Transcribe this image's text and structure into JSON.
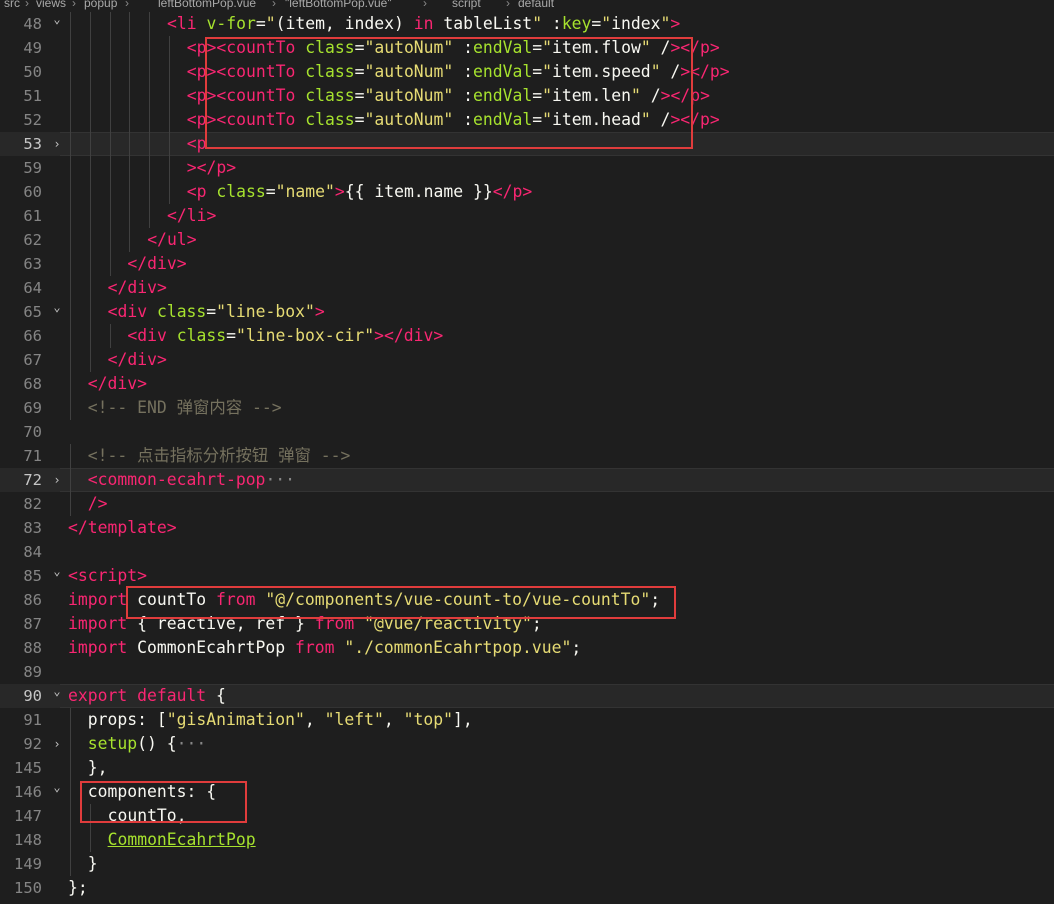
{
  "breadcrumb": {
    "items": [
      "src",
      "views",
      "popup",
      "leftBottomPop.vue",
      "\"leftBottomPop.vue\"",
      "script",
      "default"
    ],
    "icons": [
      "chevron-right-icon",
      "vue-file-icon",
      "braces-icon",
      "cube-icon",
      "symbol-icon"
    ]
  },
  "lines": [
    {
      "n": "48",
      "fold": "v",
      "indent": 5,
      "segs": [
        [
          "tag",
          "<"
        ],
        [
          "tag",
          "li"
        ],
        [
          "punc",
          " "
        ],
        [
          "attr",
          "v-for"
        ],
        [
          "punc",
          "="
        ],
        [
          "str",
          "\""
        ],
        [
          "var",
          "(item, index) "
        ],
        [
          "kw",
          "in"
        ],
        [
          "var",
          " tableList"
        ],
        [
          "str",
          "\""
        ],
        [
          "punc",
          " :"
        ],
        [
          "attr",
          "key"
        ],
        [
          "punc",
          "="
        ],
        [
          "str",
          "\""
        ],
        [
          "var",
          "index"
        ],
        [
          "str",
          "\""
        ],
        [
          "tag",
          ">"
        ]
      ]
    },
    {
      "n": "49",
      "fold": "",
      "indent": 6,
      "segs": [
        [
          "tag",
          "<"
        ],
        [
          "tag",
          "p"
        ],
        [
          "tag",
          "><"
        ],
        [
          "tag",
          "countTo"
        ],
        [
          "punc",
          " "
        ],
        [
          "attr",
          "class"
        ],
        [
          "punc",
          "="
        ],
        [
          "str",
          "\"autoNum\""
        ],
        [
          "punc",
          " :"
        ],
        [
          "attr",
          "endVal"
        ],
        [
          "punc",
          "="
        ],
        [
          "str",
          "\""
        ],
        [
          "var",
          "item.flow"
        ],
        [
          "str",
          "\""
        ],
        [
          "punc",
          " /"
        ],
        [
          "tag",
          "></"
        ],
        [
          "tag",
          "p"
        ],
        [
          "tag",
          ">"
        ]
      ]
    },
    {
      "n": "50",
      "fold": "",
      "indent": 6,
      "segs": [
        [
          "tag",
          "<"
        ],
        [
          "tag",
          "p"
        ],
        [
          "tag",
          "><"
        ],
        [
          "tag",
          "countTo"
        ],
        [
          "punc",
          " "
        ],
        [
          "attr",
          "class"
        ],
        [
          "punc",
          "="
        ],
        [
          "str",
          "\"autoNum\""
        ],
        [
          "punc",
          " :"
        ],
        [
          "attr",
          "endVal"
        ],
        [
          "punc",
          "="
        ],
        [
          "str",
          "\""
        ],
        [
          "var",
          "item.speed"
        ],
        [
          "str",
          "\""
        ],
        [
          "punc",
          " /"
        ],
        [
          "tag",
          "></"
        ],
        [
          "tag",
          "p"
        ],
        [
          "tag",
          ">"
        ]
      ]
    },
    {
      "n": "51",
      "fold": "",
      "indent": 6,
      "segs": [
        [
          "tag",
          "<"
        ],
        [
          "tag",
          "p"
        ],
        [
          "tag",
          "><"
        ],
        [
          "tag",
          "countTo"
        ],
        [
          "punc",
          " "
        ],
        [
          "attr",
          "class"
        ],
        [
          "punc",
          "="
        ],
        [
          "str",
          "\"autoNum\""
        ],
        [
          "punc",
          " :"
        ],
        [
          "attr",
          "endVal"
        ],
        [
          "punc",
          "="
        ],
        [
          "str",
          "\""
        ],
        [
          "var",
          "item.len"
        ],
        [
          "str",
          "\""
        ],
        [
          "punc",
          " /"
        ],
        [
          "tag",
          "></"
        ],
        [
          "tag",
          "p"
        ],
        [
          "tag",
          ">"
        ]
      ]
    },
    {
      "n": "52",
      "fold": "",
      "indent": 6,
      "segs": [
        [
          "tag",
          "<"
        ],
        [
          "tag",
          "p"
        ],
        [
          "tag",
          "><"
        ],
        [
          "tag",
          "countTo"
        ],
        [
          "punc",
          " "
        ],
        [
          "attr",
          "class"
        ],
        [
          "punc",
          "="
        ],
        [
          "str",
          "\"autoNum\""
        ],
        [
          "punc",
          " :"
        ],
        [
          "attr",
          "endVal"
        ],
        [
          "punc",
          "="
        ],
        [
          "str",
          "\""
        ],
        [
          "var",
          "item.head"
        ],
        [
          "str",
          "\""
        ],
        [
          "punc",
          " /"
        ],
        [
          "tag",
          "></"
        ],
        [
          "tag",
          "p"
        ],
        [
          "tag",
          ">"
        ]
      ]
    },
    {
      "n": "53",
      "fold": ">",
      "indent": 6,
      "hl": true,
      "segs": [
        [
          "tag",
          "<"
        ],
        [
          "tag",
          "p"
        ]
      ]
    },
    {
      "n": "59",
      "fold": "",
      "indent": 6,
      "segs": [
        [
          "tag",
          "></"
        ],
        [
          "tag",
          "p"
        ],
        [
          "tag",
          ">"
        ]
      ]
    },
    {
      "n": "60",
      "fold": "",
      "indent": 6,
      "segs": [
        [
          "tag",
          "<"
        ],
        [
          "tag",
          "p"
        ],
        [
          "punc",
          " "
        ],
        [
          "attr",
          "class"
        ],
        [
          "punc",
          "="
        ],
        [
          "str",
          "\"name\""
        ],
        [
          "tag",
          ">"
        ],
        [
          "var",
          "{{ item.name }}"
        ],
        [
          "tag",
          "</"
        ],
        [
          "tag",
          "p"
        ],
        [
          "tag",
          ">"
        ]
      ]
    },
    {
      "n": "61",
      "fold": "",
      "indent": 5,
      "segs": [
        [
          "tag",
          "</"
        ],
        [
          "tag",
          "li"
        ],
        [
          "tag",
          ">"
        ]
      ]
    },
    {
      "n": "62",
      "fold": "",
      "indent": 4,
      "segs": [
        [
          "tag",
          "</"
        ],
        [
          "tag",
          "ul"
        ],
        [
          "tag",
          ">"
        ]
      ]
    },
    {
      "n": "63",
      "fold": "",
      "indent": 3,
      "segs": [
        [
          "tag",
          "</"
        ],
        [
          "tag",
          "div"
        ],
        [
          "tag",
          ">"
        ]
      ]
    },
    {
      "n": "64",
      "fold": "",
      "indent": 2,
      "segs": [
        [
          "tag",
          "</"
        ],
        [
          "tag",
          "div"
        ],
        [
          "tag",
          ">"
        ]
      ]
    },
    {
      "n": "65",
      "fold": "v",
      "indent": 2,
      "segs": [
        [
          "tag",
          "<"
        ],
        [
          "tag",
          "div"
        ],
        [
          "punc",
          " "
        ],
        [
          "attr",
          "class"
        ],
        [
          "punc",
          "="
        ],
        [
          "str",
          "\"line-box\""
        ],
        [
          "tag",
          ">"
        ]
      ]
    },
    {
      "n": "66",
      "fold": "",
      "indent": 3,
      "segs": [
        [
          "tag",
          "<"
        ],
        [
          "tag",
          "div"
        ],
        [
          "punc",
          " "
        ],
        [
          "attr",
          "class"
        ],
        [
          "punc",
          "="
        ],
        [
          "str",
          "\"line-box-cir\""
        ],
        [
          "tag",
          "></"
        ],
        [
          "tag",
          "div"
        ],
        [
          "tag",
          ">"
        ]
      ]
    },
    {
      "n": "67",
      "fold": "",
      "indent": 2,
      "segs": [
        [
          "tag",
          "</"
        ],
        [
          "tag",
          "div"
        ],
        [
          "tag",
          ">"
        ]
      ]
    },
    {
      "n": "68",
      "fold": "",
      "indent": 1,
      "segs": [
        [
          "tag",
          "</"
        ],
        [
          "tag",
          "div"
        ],
        [
          "tag",
          ">"
        ]
      ]
    },
    {
      "n": "69",
      "fold": "",
      "indent": 1,
      "segs": [
        [
          "com",
          "<!-- END 弹窗内容 -->"
        ]
      ]
    },
    {
      "n": "70",
      "fold": "",
      "indent": 0,
      "segs": []
    },
    {
      "n": "71",
      "fold": "",
      "indent": 1,
      "segs": [
        [
          "com",
          "<!-- 点击指标分析按钮 弹窗 -->"
        ]
      ]
    },
    {
      "n": "72",
      "fold": ">",
      "indent": 1,
      "hl": true,
      "segs": [
        [
          "tag",
          "<"
        ],
        [
          "tag",
          "common-ecahrt-pop"
        ],
        [
          "dim",
          "···"
        ]
      ]
    },
    {
      "n": "82",
      "fold": "",
      "indent": 1,
      "segs": [
        [
          "tag",
          "/>"
        ]
      ]
    },
    {
      "n": "83",
      "fold": "",
      "indent": 0,
      "segs": [
        [
          "tag",
          "</"
        ],
        [
          "tag",
          "template"
        ],
        [
          "tag",
          ">"
        ]
      ]
    },
    {
      "n": "84",
      "fold": "",
      "indent": 0,
      "segs": []
    },
    {
      "n": "85",
      "fold": "v",
      "indent": 0,
      "segs": [
        [
          "tag",
          "<"
        ],
        [
          "tag",
          "script"
        ],
        [
          "tag",
          ">"
        ]
      ]
    },
    {
      "n": "86",
      "fold": "",
      "indent": 0,
      "segs": [
        [
          "kw",
          "import"
        ],
        [
          "var",
          " countTo "
        ],
        [
          "kw",
          "from"
        ],
        [
          "var",
          " "
        ],
        [
          "str",
          "\"@/components/vue-count-to/vue-countTo\""
        ],
        [
          "var",
          ";"
        ]
      ]
    },
    {
      "n": "87",
      "fold": "",
      "indent": 0,
      "segs": [
        [
          "kw",
          "import"
        ],
        [
          "var",
          " { reactive, ref } "
        ],
        [
          "kw",
          "from"
        ],
        [
          "var",
          " "
        ],
        [
          "str",
          "\"@vue/reactivity\""
        ],
        [
          "var",
          ";"
        ]
      ]
    },
    {
      "n": "88",
      "fold": "",
      "indent": 0,
      "segs": [
        [
          "kw",
          "import"
        ],
        [
          "var",
          " CommonEcahrtPop "
        ],
        [
          "kw",
          "from"
        ],
        [
          "var",
          " "
        ],
        [
          "str",
          "\"./commonEcahrtpop.vue\""
        ],
        [
          "var",
          ";"
        ]
      ]
    },
    {
      "n": "89",
      "fold": "",
      "indent": 0,
      "segs": []
    },
    {
      "n": "90",
      "fold": "v",
      "indent": 0,
      "hl": true,
      "segs": [
        [
          "kw",
          "export"
        ],
        [
          "var",
          " "
        ],
        [
          "kw",
          "default"
        ],
        [
          "var",
          " {"
        ]
      ]
    },
    {
      "n": "91",
      "fold": "",
      "indent": 1,
      "segs": [
        [
          "var",
          "props: ["
        ],
        [
          "str",
          "\"gisAnimation\""
        ],
        [
          "var",
          ", "
        ],
        [
          "str",
          "\"left\""
        ],
        [
          "var",
          ", "
        ],
        [
          "str",
          "\"top\""
        ],
        [
          "var",
          "],"
        ]
      ]
    },
    {
      "n": "92",
      "fold": ">",
      "indent": 1,
      "segs": [
        [
          "fn",
          "setup"
        ],
        [
          "var",
          "() {"
        ],
        [
          "dim",
          "···"
        ]
      ]
    },
    {
      "n": "145",
      "fold": "",
      "indent": 1,
      "segs": [
        [
          "var",
          "},"
        ]
      ]
    },
    {
      "n": "146",
      "fold": "v",
      "indent": 1,
      "segs": [
        [
          "var",
          "components: {"
        ]
      ]
    },
    {
      "n": "147",
      "fold": "",
      "indent": 2,
      "segs": [
        [
          "var",
          "countTo,"
        ]
      ]
    },
    {
      "n": "148",
      "fold": "",
      "indent": 2,
      "segs": [
        [
          "comp",
          "CommonEcahrtPop"
        ]
      ]
    },
    {
      "n": "149",
      "fold": "",
      "indent": 1,
      "segs": [
        [
          "var",
          "}"
        ]
      ]
    },
    {
      "n": "150",
      "fold": "",
      "indent": 0,
      "segs": [
        [
          "var",
          "};"
        ]
      ]
    }
  ]
}
